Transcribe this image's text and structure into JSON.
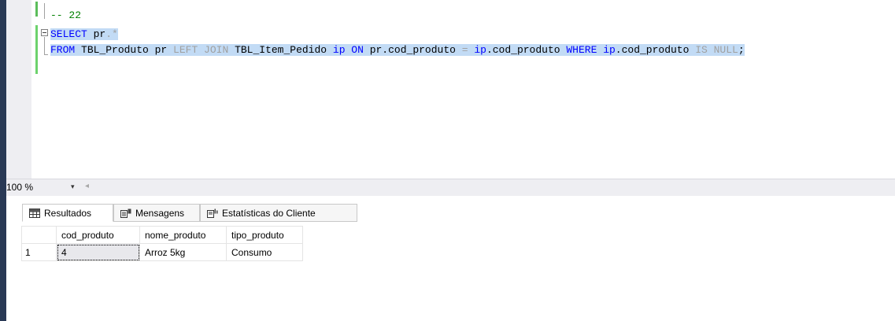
{
  "editor": {
    "comment_line": "-- 22",
    "line2": {
      "kw": "SELECT",
      "rest": " pr",
      "dot_star": ".*"
    },
    "line3": {
      "from": "FROM",
      "t1": " TBL_Produto pr ",
      "left_join": "LEFT JOIN",
      "t2": " TBL_Item_Pedido ",
      "ip": "ip",
      "on": " ON",
      "cond1": " pr.cod_produto ",
      "eq": "=",
      "ip2": " ip",
      "cond2": ".cod_produto ",
      "where": "WHERE",
      "ip3": " ip",
      "cond3": ".cod_produto ",
      "isnull": "IS NULL",
      "semi": ";"
    }
  },
  "statusbar": {
    "zoom": "100 %",
    "zoom_arrow": "▾",
    "scroll_left": "◂"
  },
  "tabs": [
    {
      "label": "Resultados",
      "icon": "grid-icon"
    },
    {
      "label": "Mensagens",
      "icon": "messages-icon"
    },
    {
      "label": "Estatísticas do Cliente",
      "icon": "stats-icon"
    }
  ],
  "results": {
    "columns": [
      "cod_produto",
      "nome_produto",
      "tipo_produto"
    ],
    "rows": [
      {
        "num": "1",
        "cells": [
          "4",
          "Arroz 5kg",
          "Consumo"
        ]
      }
    ]
  },
  "colors": {
    "keyword": "#0000ff",
    "comment": "#008000",
    "selection": "#c2dbf5",
    "dark_bar": "#293955"
  }
}
